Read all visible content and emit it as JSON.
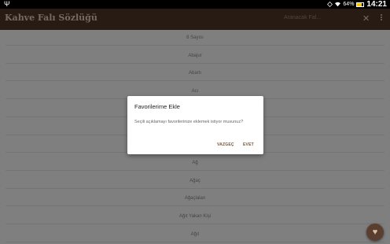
{
  "status_bar": {
    "battery_percent": "64%",
    "battery_level": 0.64,
    "time": "14:21"
  },
  "app_bar": {
    "title": "Kahve Falı Sözlüğü",
    "search_placeholder": "Aranacak Fal..."
  },
  "list_items": [
    "8 Sayısı",
    "Abajur",
    "Abartı",
    "Acı",
    "",
    "",
    "",
    "Ağ",
    "Ağaç",
    "Ağaçlalan",
    "Ağıt Yakan Kişi",
    "Ağıt"
  ],
  "dialog": {
    "title": "Favorilerime Ekle",
    "message": "Seçili açıklamayı favorilerinize eklemek istiyor musunuz?",
    "cancel_label": "VAZGEÇ",
    "ok_label": "EVET"
  },
  "colors": {
    "app_bar": "#4e3629",
    "accent": "#7a5438"
  }
}
